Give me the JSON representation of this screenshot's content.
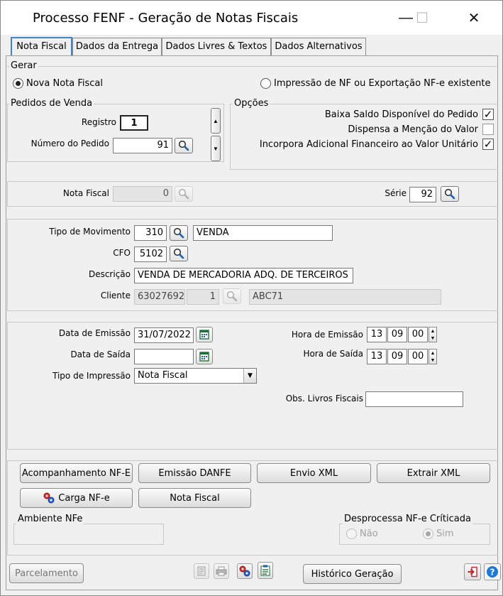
{
  "window": {
    "title": "Processo FENF - Geração de Notas Fiscais",
    "minimize_glyph": "—",
    "maximize_glyph": "☐",
    "close_glyph": "✕"
  },
  "tabs": [
    {
      "label": "Nota Fiscal",
      "active": true
    },
    {
      "label": "Dados da Entrega",
      "active": false
    },
    {
      "label": "Dados Livres & Textos",
      "active": false
    },
    {
      "label": "Dados Alternativos",
      "active": false
    }
  ],
  "gerar": {
    "label": "Gerar",
    "option_new": "Nova Nota Fiscal",
    "option_existing": "Impressão de NF ou Exportação NF-e existente",
    "selected": "new"
  },
  "pedidos": {
    "label": "Pedidos de Venda",
    "registro_label": "Registro",
    "registro_value": "1",
    "numero_label": "Número do Pedido",
    "numero_value": "91"
  },
  "opcoes": {
    "label": "Opções",
    "items": [
      {
        "label": "Baixa Saldo Disponível do Pedido",
        "checked": true
      },
      {
        "label": "Dispensa a Menção do Valor",
        "checked": false
      },
      {
        "label": "Incorpora Adicional Financeiro ao Valor Unitário",
        "checked": true
      }
    ]
  },
  "nota": {
    "nota_label": "Nota Fiscal",
    "nota_value": "0",
    "serie_label": "Série",
    "serie_value": "92"
  },
  "movimento": {
    "tipo_label": "Tipo de Movimento",
    "tipo_code": "310",
    "tipo_desc": "VENDA",
    "cfo_label": "CFO",
    "cfo_value": "5102",
    "descricao_label": "Descrição",
    "descricao_value": "VENDA DE MERCADORIA ADQ. DE TERCEIROS",
    "cliente_label": "Cliente",
    "cliente_code": "63027692",
    "cliente_seq": "1",
    "cliente_name": "ABC71"
  },
  "datas": {
    "emissao_label": "Data de Emissão",
    "emissao_value": "31/07/2022",
    "saida_label": "Data de Saída",
    "saida_value": "",
    "tipo_impressao_label": "Tipo de Impressão",
    "tipo_impressao_value": "Nota Fiscal",
    "hora_emissao_label": "Hora de Emissão",
    "hora_emissao": [
      "13",
      "09",
      "00"
    ],
    "hora_saida_label": "Hora de Saída",
    "hora_saida": [
      "13",
      "09",
      "00"
    ],
    "obs_label": "Obs. Livros Fiscais",
    "obs_value": ""
  },
  "actions": {
    "acompanhamento": "Acompanhamento NF-E",
    "emissao_danfe": "Emissão DANFE",
    "envio_xml": "Envio XML",
    "extrair_xml": "Extrair XML",
    "carga_nfe": "Carga NF-e",
    "nota_fiscal": "Nota Fiscal"
  },
  "ambiente": {
    "label": "Ambiente NFe",
    "value": ""
  },
  "desprocessa": {
    "label": "Desprocessa NF-e Críticada",
    "option_no": "Não",
    "option_yes": "Sim",
    "selected": "yes"
  },
  "footer": {
    "parcelamento": "Parcelamento",
    "historico": "Histórico Geração"
  },
  "colors": {
    "tab_accent": "#3f84cc",
    "search_icon": "#1f5fa8",
    "help_icon": "#1e78d6",
    "exit_icon": "#c0262d"
  }
}
